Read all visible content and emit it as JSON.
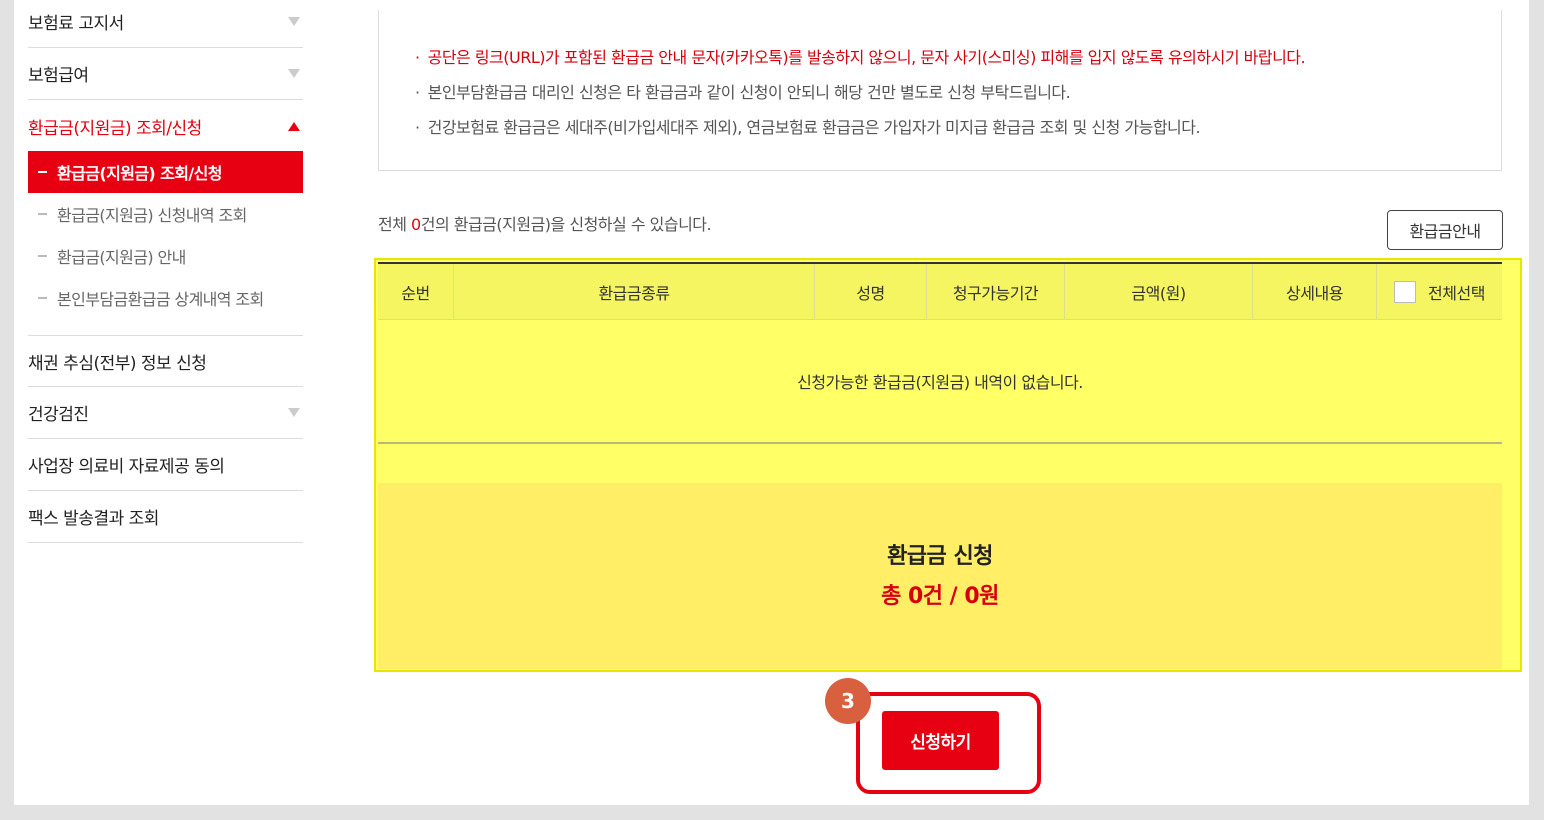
{
  "sidebar": {
    "items": [
      {
        "label": "보험료 고지서",
        "expandable": true
      },
      {
        "label": "보험급여",
        "expandable": true
      },
      {
        "label": "환급금(지원금) 조회/신청",
        "expandable": true,
        "active": true
      },
      {
        "label": "채권 추심(전부) 정보 신청",
        "expandable": false
      },
      {
        "label": "건강검진",
        "expandable": true
      },
      {
        "label": "사업장 의료비 자료제공 동의",
        "expandable": false
      },
      {
        "label": "팩스 발송결과 조회",
        "expandable": false
      }
    ],
    "submenu": [
      {
        "label": "환급금(지원금) 조회/신청",
        "active": true
      },
      {
        "label": "환급금(지원금) 신청내역 조회"
      },
      {
        "label": "환급금(지원금) 안내"
      },
      {
        "label": "본인부담금환급금 상계내역 조회"
      }
    ]
  },
  "notices": {
    "bullet": "·",
    "items": [
      "공단은 링크(URL)가 포함된 환급금 안내 문자(카카오톡)를 발송하지 않으니, 문자 사기(스미싱) 피해를 입지 않도록 유의하시기 바랍니다.",
      "본인부담환급금 대리인 신청은 타 환급금과 같이 신청이 안되니 해당 건만 별도로 신청 부탁드립니다.",
      "건강보험료 환급금은 세대주(비가입세대주 제외), 연금보험료 환급금은 가입자가 미지급 환급금 조회 및 신청 가능합니다."
    ]
  },
  "summary_line": {
    "prefix": "전체 ",
    "count": "0",
    "suffix": "건의 환급금(지원금)을 신청하실 수 있습니다."
  },
  "guide_button": "환급금안내",
  "table": {
    "columns": [
      "순번",
      "환급금종류",
      "성명",
      "청구가능기간",
      "금액(원)",
      "상세내용",
      "전체선택"
    ],
    "empty_message": "신청가능한 환급금(지원금) 내역이 없습니다."
  },
  "apply_summary": {
    "title": "환급금 신청",
    "total": "총 0건 / 0원"
  },
  "submit_button": "신청하기",
  "step_badge": "3",
  "colors": {
    "accent_red": "#e60012",
    "highlight_yellow": "#ffff66",
    "badge": "#d9603f"
  }
}
